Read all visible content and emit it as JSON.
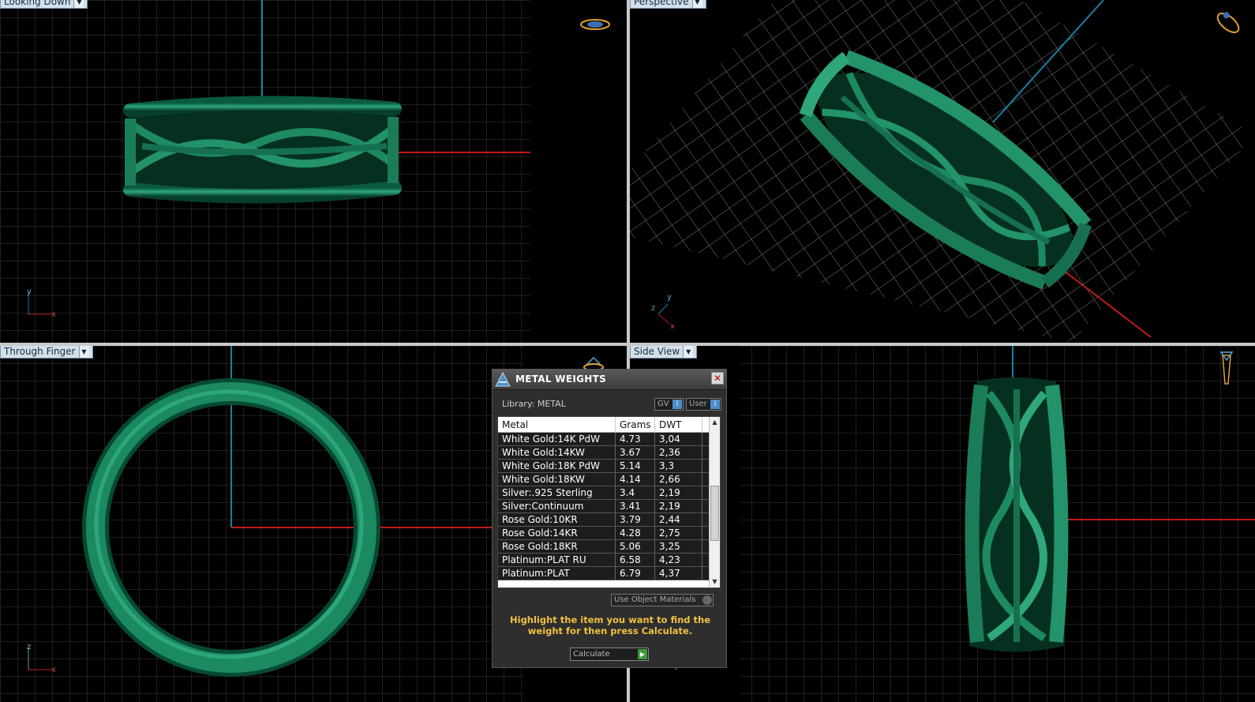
{
  "viewports": {
    "top_left": {
      "label": "Looking Down",
      "axis_h": "x",
      "axis_v": "y"
    },
    "top_right": {
      "label": "Perspective",
      "axis_a": "z",
      "axis_b": "y",
      "axis_c": "x"
    },
    "bottom_left": {
      "label": "Through Finger",
      "axis_h": "x",
      "axis_v": "z"
    },
    "bottom_right": {
      "label": "Side View",
      "axis_h": "y"
    }
  },
  "dialog": {
    "title": "METAL WEIGHTS",
    "library": "Library: METAL",
    "toggle_gv": "GV",
    "toggle_user": "User",
    "columns": [
      "Metal",
      "Grams",
      "DWT"
    ],
    "rows": [
      [
        "White Gold:14K PdW",
        "4.73",
        "3,04"
      ],
      [
        "White Gold:14KW",
        "3.67",
        "2,36"
      ],
      [
        "White Gold:18K PdW",
        "5.14",
        "3,3"
      ],
      [
        "White Gold:18KW",
        "4.14",
        "2,66"
      ],
      [
        "Silver:.925 Sterling",
        "3.4",
        "2,19"
      ],
      [
        "Silver:Continuum",
        "3.41",
        "2,19"
      ],
      [
        "Rose Gold:10KR",
        "3.79",
        "2,44"
      ],
      [
        "Rose Gold:14KR",
        "4.28",
        "2,75"
      ],
      [
        "Rose Gold:18KR",
        "5.06",
        "3,25"
      ],
      [
        "Platinum:PLAT RU",
        "6.58",
        "4,23"
      ],
      [
        "Platinum:PLAT",
        "6.79",
        "4,37"
      ]
    ],
    "use_object_materials": "Use Object Materials",
    "hint": "Highlight the item you want to find the weight for then press Calculate.",
    "calculate": "Calculate"
  },
  "colors": {
    "ring": "#0e7a55",
    "grid": "#3a3a3a",
    "axis_x": "#c11b1b",
    "axis_y": "#1a7fa0",
    "gizmo": "#e0a030"
  }
}
